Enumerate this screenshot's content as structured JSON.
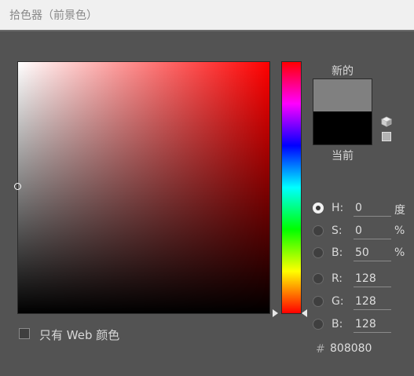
{
  "dialog": {
    "title": "拾色器（前景色）"
  },
  "picker": {
    "hue_color": "#ff0000",
    "selected_color": "#808080"
  },
  "preview": {
    "new_label": "新的",
    "current_label": "当前",
    "new_color": "#808080",
    "current_color": "#000000"
  },
  "hsb": [
    {
      "label": "H:",
      "value": "0",
      "unit": "度",
      "checked": true
    },
    {
      "label": "S:",
      "value": "0",
      "unit": "%",
      "checked": false
    },
    {
      "label": "B:",
      "value": "50",
      "unit": "%",
      "checked": false
    }
  ],
  "rgb": [
    {
      "label": "R:",
      "value": "128",
      "checked": false
    },
    {
      "label": "G:",
      "value": "128",
      "checked": false
    },
    {
      "label": "B:",
      "value": "128",
      "checked": false
    }
  ],
  "hex": {
    "label": "#",
    "value": "808080"
  },
  "web_only": {
    "label": "只有 Web 颜色",
    "checked": false
  },
  "icons": {
    "out_of_gamut": "cube-icon",
    "websafe": "websafe-swatch-icon"
  }
}
